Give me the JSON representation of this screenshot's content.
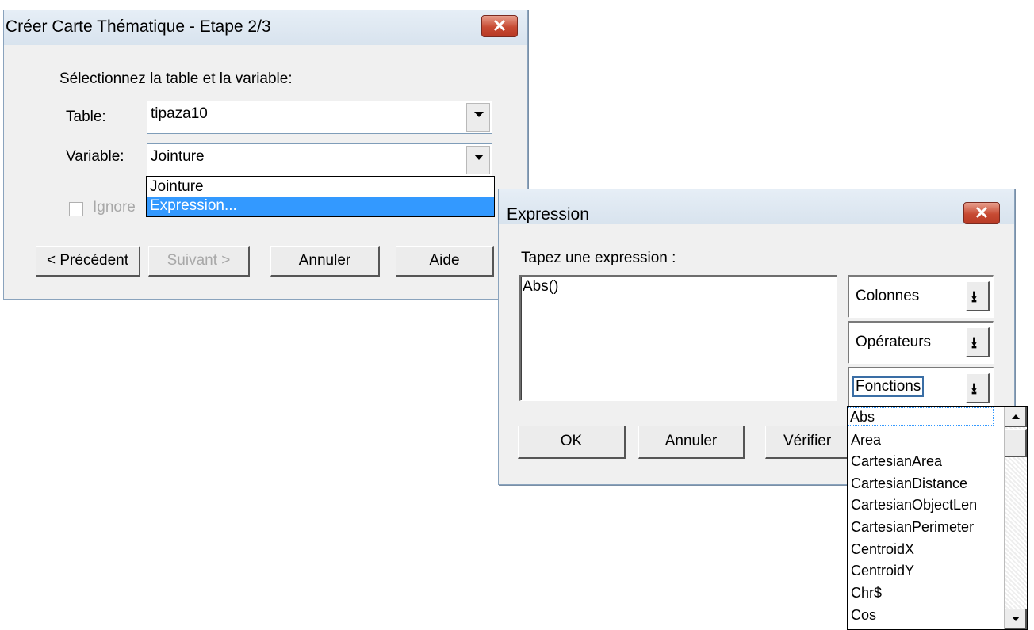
{
  "dialog1": {
    "title": "Créer Carte Thématique - Etape 2/3",
    "instruction": "Sélectionnez la table et la variable:",
    "table_label": "Table:",
    "table_value": "tipaza10",
    "variable_label": "Variable:",
    "variable_value": "Jointure",
    "variable_options": [
      "Jointure",
      "Expression..."
    ],
    "ignore_label": "Ignore",
    "buttons": {
      "prev": "< Précédent",
      "next": "Suivant >",
      "cancel": "Annuler",
      "help": "Aide"
    }
  },
  "dialog2": {
    "title": "Expression",
    "prompt": "Tapez une expression :",
    "expression": "Abs()",
    "columns_label": "Colonnes",
    "operators_label": "Opérateurs",
    "functions_label": "Fonctions",
    "buttons": {
      "ok": "OK",
      "cancel": "Annuler",
      "verify": "Vérifier"
    },
    "functions": [
      "Abs",
      "Area",
      "CartesianArea",
      "CartesianDistance",
      "CartesianObjectLen",
      "CartesianPerimeter",
      "CentroidX",
      "CentroidY",
      "Chr$",
      "Cos"
    ]
  }
}
